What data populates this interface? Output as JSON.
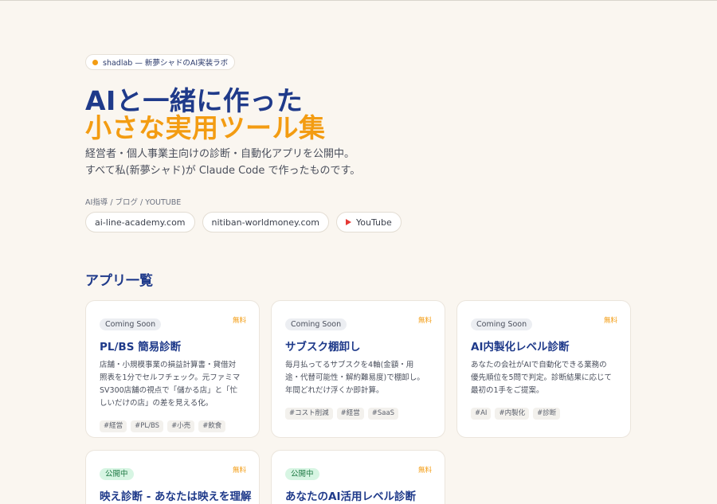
{
  "brand": {
    "badge": "shadlab — 新夢シャドのAI実装ラボ",
    "accent": "#f39c12",
    "primary": "#1f3a8a"
  },
  "hero": {
    "line1": "AIと一緒に作った",
    "line2": "小さな実用ツール集",
    "lead": [
      "経営者・個人事業主向けの診断・自動化アプリを公開中。",
      "すべて私(新夢シャド)が Claude Code で作ったものです。"
    ]
  },
  "links": {
    "label": "AI指導 / ブログ / YOUTUBE",
    "items": [
      {
        "label": "ai-line-academy.com"
      },
      {
        "label": "nitiban-worldmoney.com"
      },
      {
        "label": "YouTube",
        "icon": "youtube-play-icon"
      }
    ]
  },
  "apps": {
    "section_title": "アプリ一覧",
    "cards": [
      {
        "status": "Coming Soon",
        "price": "無料",
        "title": "PL/BS 簡易診断",
        "desc": [
          "店舗・小規模事業の損益計算書・貸借対",
          "照表を1分でセルフチェック。元ファミマ",
          "SV300店舗の視点で「儲かる店」と「忙",
          "しいだけの店」の差を見える化。"
        ],
        "tags": [
          "#経営",
          "#PL/BS",
          "#小売",
          "#飲食"
        ]
      },
      {
        "status": "Coming Soon",
        "price": "無料",
        "title": "サブスク棚卸し",
        "desc": [
          "毎月払ってるサブスクを4軸(金額・用",
          "途・代替可能性・解約難易度)で棚卸し。",
          "年間どれだけ浮くか即計算。"
        ],
        "tags": [
          "#コスト削減",
          "#経営",
          "#SaaS"
        ]
      },
      {
        "status": "Coming Soon",
        "price": "無料",
        "title": "AI内製化レベル診断",
        "desc": [
          "あなたの会社がAIで自動化できる業務の",
          "優先順位を5問で判定。診断結果に応じて",
          "最初の1手をご提案。"
        ],
        "tags": [
          "#AI",
          "#内製化",
          "#診断"
        ]
      },
      {
        "status": "公開中",
        "price": "無料",
        "title": "映え診断 - あなたは映えを理解",
        "desc": [],
        "tags": []
      },
      {
        "status": "公開中",
        "price": "無料",
        "title": "あなたのAI活用レベル診断",
        "desc": [],
        "tags": []
      }
    ]
  }
}
